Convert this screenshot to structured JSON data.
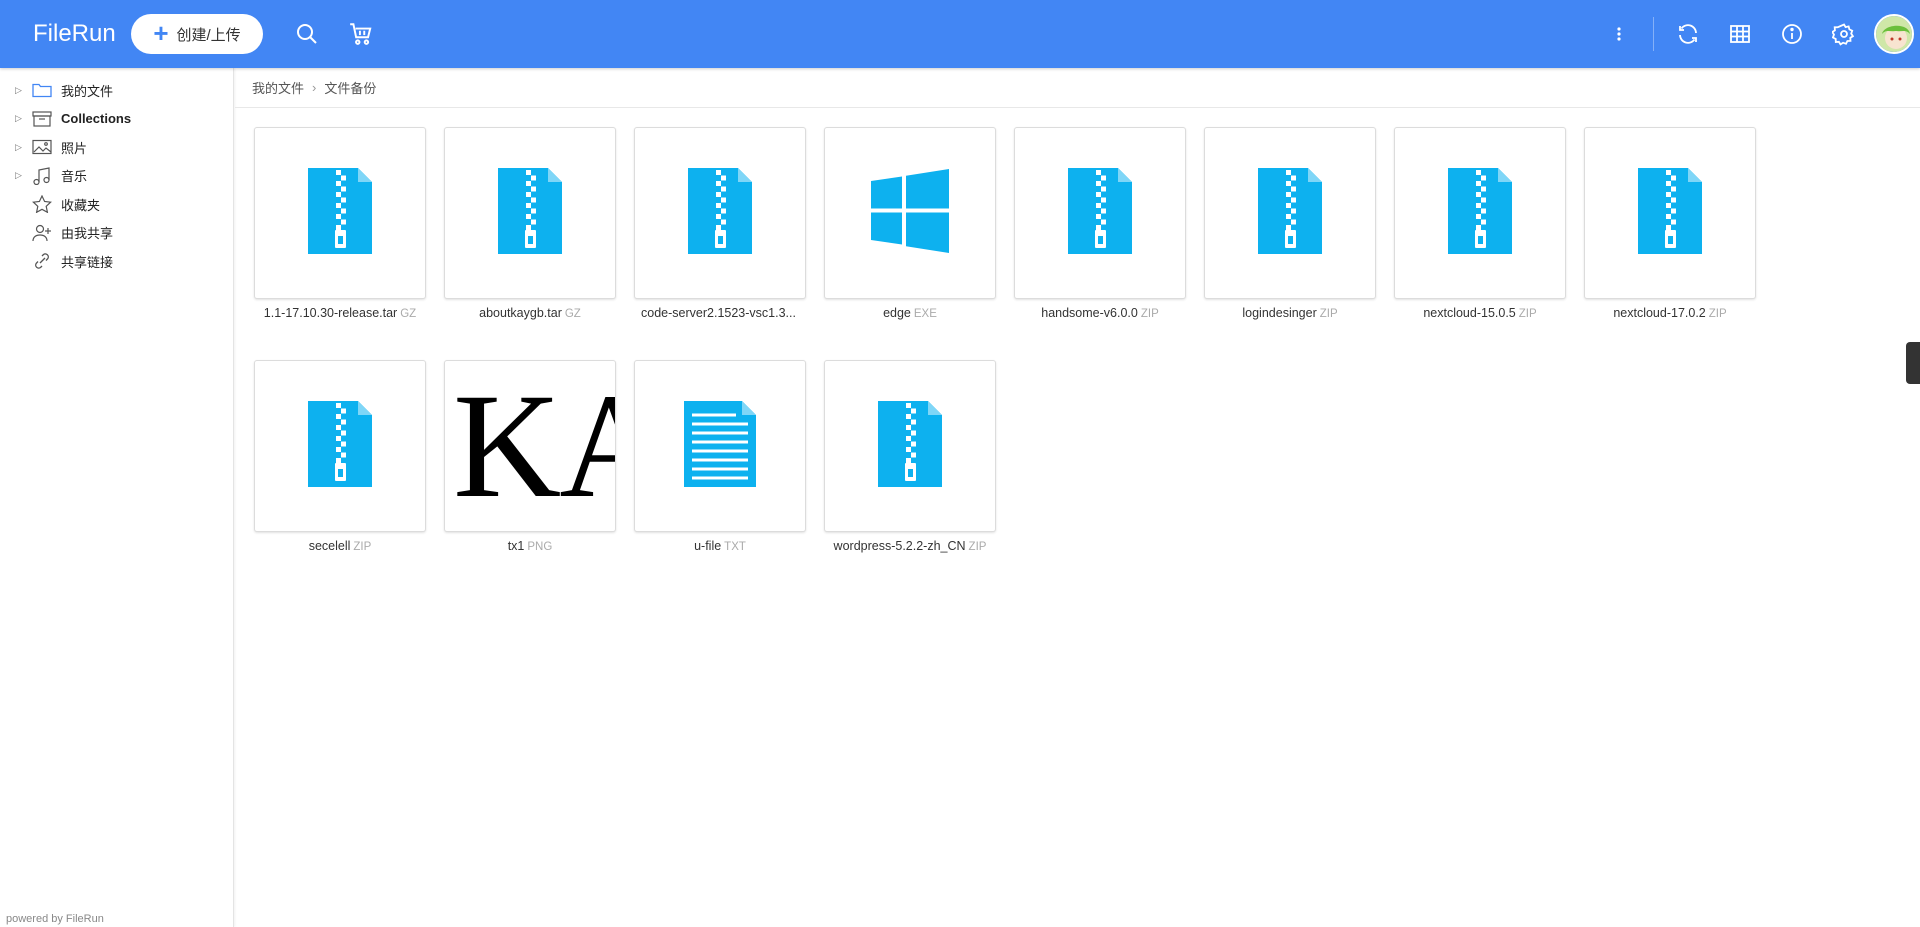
{
  "app": {
    "logo": "FileRun"
  },
  "toolbar": {
    "new_upload_label": "创建/上传",
    "brand_color": "#4286f4",
    "icons": [
      "search-icon",
      "cart-icon",
      "more-vert-icon",
      "refresh-icon",
      "grid-view-icon",
      "info-icon",
      "settings-icon",
      "avatar"
    ]
  },
  "sidebar": {
    "items": [
      {
        "label": "我的文件",
        "icon": "folder-icon",
        "expandable": true
      },
      {
        "label": "Collections",
        "icon": "archive-box-icon",
        "expandable": true
      },
      {
        "label": "照片",
        "icon": "photo-icon",
        "expandable": true
      },
      {
        "label": "音乐",
        "icon": "music-icon",
        "expandable": true
      },
      {
        "label": "收藏夹",
        "icon": "star-icon",
        "expandable": false
      },
      {
        "label": "由我共享",
        "icon": "shared-user-icon",
        "expandable": false
      },
      {
        "label": "共享链接",
        "icon": "link-icon",
        "expandable": false
      }
    ],
    "powered_by": "powered by FileRun"
  },
  "breadcrumb": {
    "root": "我的文件",
    "separator": "›",
    "current": "文件备份"
  },
  "files": [
    {
      "name": "1.1-17.10.30-release.tar",
      "ext": "GZ",
      "icon": "archive-icon"
    },
    {
      "name": "aboutkaygb.tar",
      "ext": "GZ",
      "icon": "archive-icon"
    },
    {
      "name": "code-server2.1523-vsc1.3...",
      "ext": "",
      "icon": "archive-icon"
    },
    {
      "name": "edge",
      "ext": "EXE",
      "icon": "windows-icon"
    },
    {
      "name": "handsome-v6.0.0",
      "ext": "ZIP",
      "icon": "archive-icon"
    },
    {
      "name": "logindesinger",
      "ext": "ZIP",
      "icon": "archive-icon"
    },
    {
      "name": "nextcloud-15.0.5",
      "ext": "ZIP",
      "icon": "archive-icon"
    },
    {
      "name": "nextcloud-17.0.2",
      "ext": "ZIP",
      "icon": "archive-icon"
    },
    {
      "name": "secelell",
      "ext": "ZIP",
      "icon": "archive-icon"
    },
    {
      "name": "tx1",
      "ext": "PNG",
      "icon": "image-thumbnail",
      "thumb_text": "KAT"
    },
    {
      "name": "u-file",
      "ext": "TXT",
      "icon": "text-file-icon"
    },
    {
      "name": "wordpress-5.2.2-zh_CN",
      "ext": "ZIP",
      "icon": "archive-icon"
    }
  ],
  "icon_color": "#0db1ef"
}
